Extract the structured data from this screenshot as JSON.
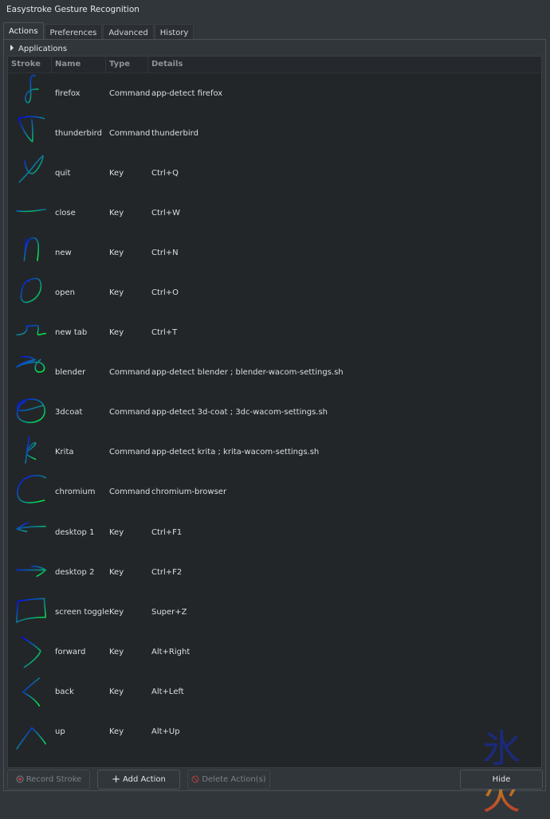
{
  "window": {
    "title": "Easystroke Gesture Recognition"
  },
  "tabs": [
    {
      "label": "Actions",
      "active": true
    },
    {
      "label": "Preferences",
      "active": false
    },
    {
      "label": "Advanced",
      "active": false
    },
    {
      "label": "History",
      "active": false
    }
  ],
  "applications_label": "Applications",
  "columns": [
    "Stroke",
    "Name",
    "Type",
    "Details"
  ],
  "actions": [
    {
      "name": "firefox",
      "type": "Command",
      "details": "app-detect firefox",
      "stroke_icon": "f-shape-stroke"
    },
    {
      "name": "thunderbird",
      "type": "Command",
      "details": "thunderbird",
      "stroke_icon": "t-shape-stroke"
    },
    {
      "name": "quit",
      "type": "Key",
      "details": "Ctrl+Q",
      "stroke_icon": "q-shape-stroke"
    },
    {
      "name": "close",
      "type": "Key",
      "details": "Ctrl+W",
      "stroke_icon": "horizontal-line-stroke"
    },
    {
      "name": "new",
      "type": "Key",
      "details": "Ctrl+N",
      "stroke_icon": "n-shape-stroke"
    },
    {
      "name": "open",
      "type": "Key",
      "details": "Ctrl+O",
      "stroke_icon": "o-shape-stroke"
    },
    {
      "name": "new tab",
      "type": "Key",
      "details": "Ctrl+T",
      "stroke_icon": "step-shape-stroke"
    },
    {
      "name": "blender",
      "type": "Command",
      "details": "app-detect blender ; blender-wacom-settings.sh",
      "stroke_icon": "b-scribble-stroke"
    },
    {
      "name": "3dcoat",
      "type": "Command",
      "details": "app-detect 3d-coat ; 3dc-wacom-settings.sh",
      "stroke_icon": "circle-loop-stroke"
    },
    {
      "name": "Krita",
      "type": "Command",
      "details": "app-detect krita ; krita-wacom-settings.sh",
      "stroke_icon": "k-shape-stroke"
    },
    {
      "name": "chromium",
      "type": "Command",
      "details": "chromium-browser",
      "stroke_icon": "c-shape-stroke"
    },
    {
      "name": "desktop 1",
      "type": "Key",
      "details": "Ctrl+F1",
      "stroke_icon": "left-arrow-stroke"
    },
    {
      "name": "desktop 2",
      "type": "Key",
      "details": "Ctrl+F2",
      "stroke_icon": "right-arrow-stroke"
    },
    {
      "name": "screen toggle",
      "type": "Key",
      "details": "Super+Z",
      "stroke_icon": "rectangle-stroke"
    },
    {
      "name": "forward",
      "type": "Key",
      "details": "Alt+Right",
      "stroke_icon": "greater-than-stroke"
    },
    {
      "name": "back",
      "type": "Key",
      "details": "Alt+Left",
      "stroke_icon": "less-than-stroke"
    },
    {
      "name": "up",
      "type": "Key",
      "details": "Alt+Up",
      "stroke_icon": "caret-up-stroke"
    }
  ],
  "buttons": {
    "record_stroke": "Record Stroke",
    "add_action": "Add Action",
    "delete_actions": "Delete Action(s)",
    "hide": "Hide"
  },
  "watermark": {
    "top_char": "氷",
    "bottom_char": "火"
  },
  "colors": {
    "stroke_start": "#0000ff",
    "stroke_end": "#00ff33",
    "watermark_top": "#1b2a7a",
    "watermark_bottom": "#c0402a"
  }
}
